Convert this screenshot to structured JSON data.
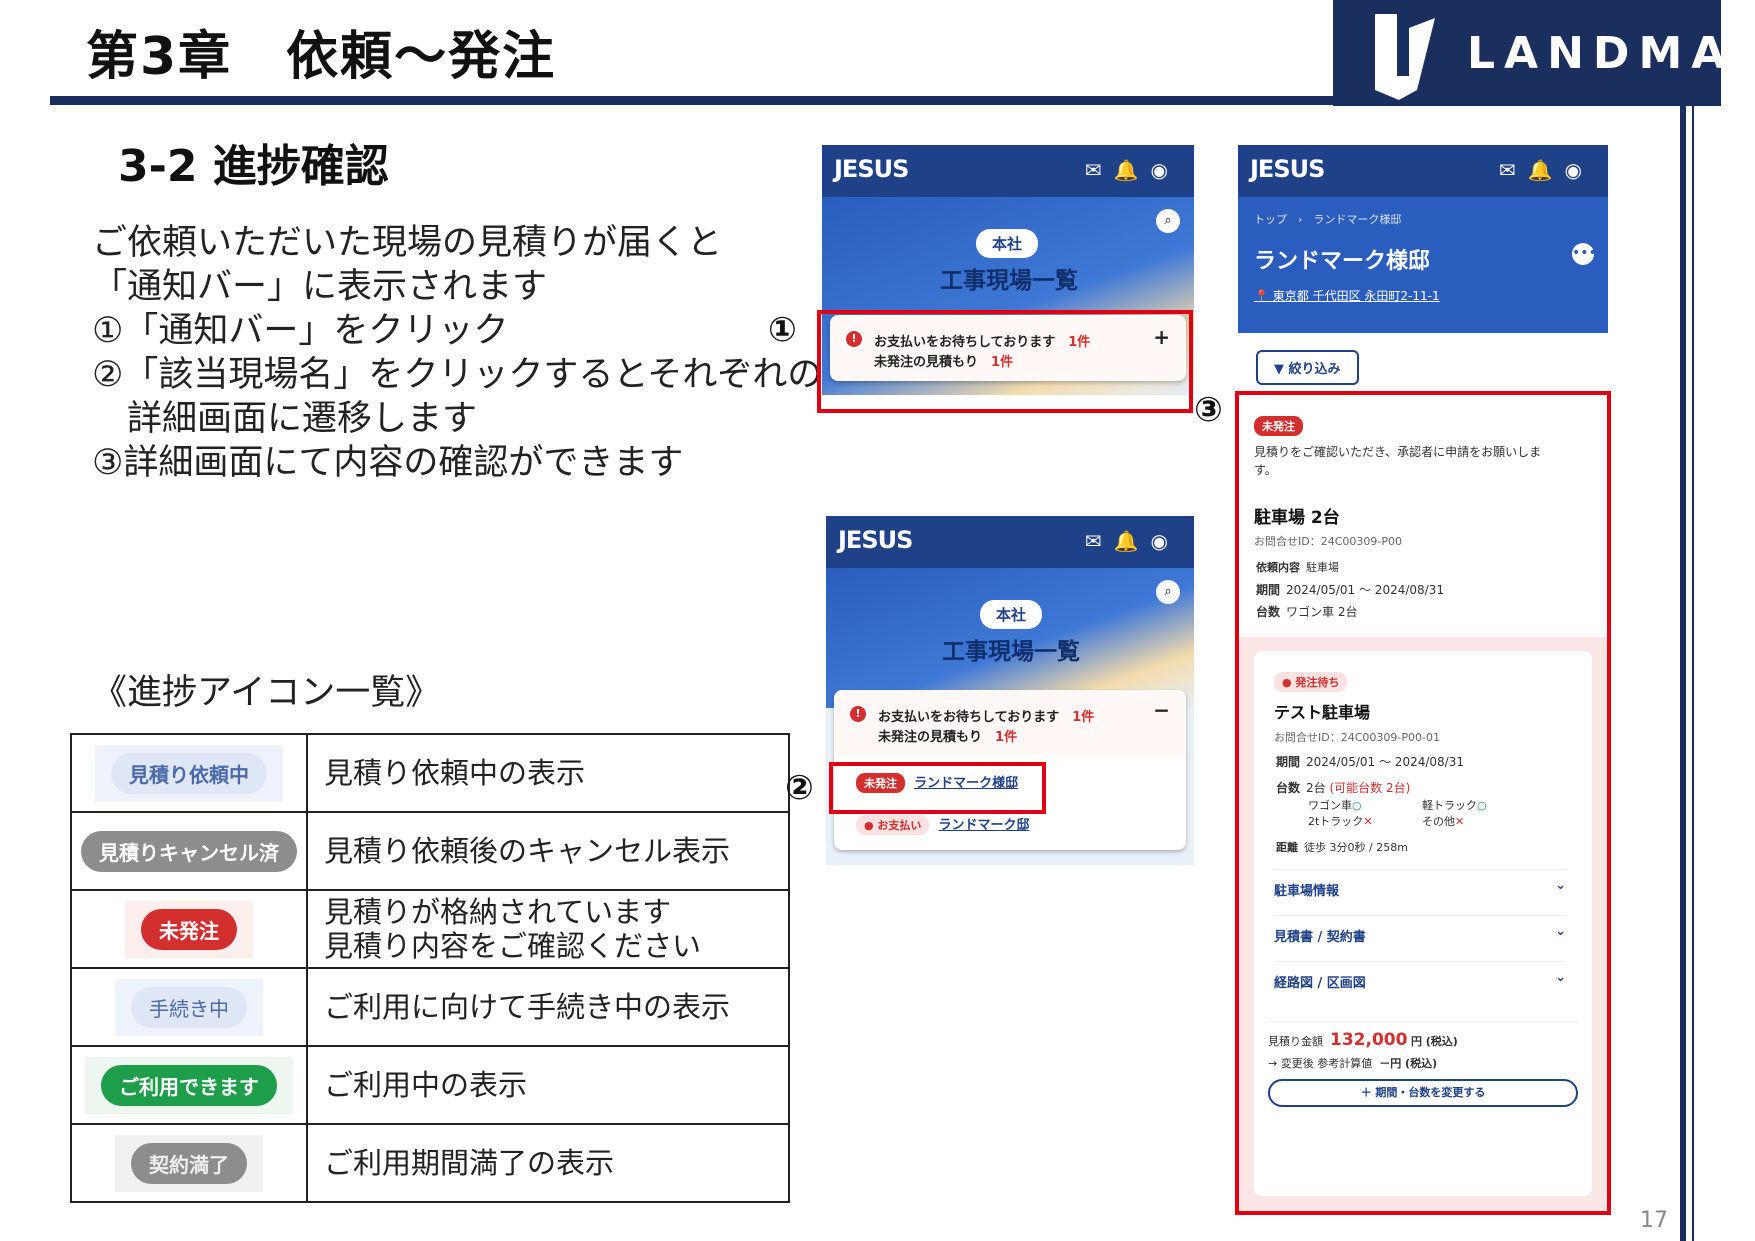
{
  "header": {
    "chapter_title": "第3章　依頼〜発注",
    "logo_text": "LANDMARK",
    "page_number": "17"
  },
  "section": {
    "title": "3-2 進捗確認",
    "lines": [
      "ご依頼いただいた現場の見積りが届くと",
      "「通知バー」に表示されます",
      "①「通知バー」をクリック",
      "②「該当現場名」をクリックするとそれぞれの",
      "　詳細画面に遷移します",
      "③詳細画面にて内容の確認ができます"
    ]
  },
  "icon_list": {
    "title": "《進捗アイコン一覧》",
    "rows": [
      {
        "badge": "見積り依頼中",
        "desc": "見積り依頼中の表示",
        "badge_bg": "#dfe7f6",
        "badge_fg": "#4a6aa8"
      },
      {
        "badge": "見積りキャンセル済",
        "desc": "見積り依頼後のキャンセル表示",
        "badge_bg": "#8d8d8d",
        "badge_fg": "#ffffff"
      },
      {
        "badge": "未発注",
        "desc": "見積りが格納されています",
        "desc2": "見積り内容をご確認ください",
        "badge_bg": "#d32f2f",
        "badge_fg": "#ffffff"
      },
      {
        "badge": "手続き中",
        "desc": "ご利用に向けて手続き中の表示",
        "badge_bg": "#dfe7f6",
        "badge_fg": "#4a6aa8"
      },
      {
        "badge": "ご利用できます",
        "desc": "ご利用中の表示",
        "badge_bg": "#1e9e4a",
        "badge_fg": "#ffffff"
      },
      {
        "badge": "契約満了",
        "desc": "ご利用期間満了の表示",
        "badge_bg": "#8d8d8d",
        "badge_fg": "#ffffff"
      }
    ]
  },
  "screen1": {
    "app_name": "JESUS",
    "hq_label": "本社",
    "title": "工事現場一覧",
    "notif_line1": "お支払いをお待ちしております",
    "notif_count1": "1件",
    "notif_line2": "未発注の見積もり",
    "notif_count2": "1件",
    "toggle": "+",
    "step": "①"
  },
  "screen2": {
    "app_name": "JESUS",
    "hq_label": "本社",
    "title": "工事現場一覧",
    "notif_line1": "お支払いをお待ちしております",
    "notif_count1": "1件",
    "notif_line2": "未発注の見積もり",
    "notif_count2": "1件",
    "toggle": "−",
    "item1_tag": "未発注",
    "item1_link": "ランドマーク様邸",
    "item2_tag": "● お支払い",
    "item2_link": "ランドマーク邸",
    "step": "②"
  },
  "screen3": {
    "app_name": "JESUS",
    "breadcrumb_top": "トップ",
    "breadcrumb_sep": "›",
    "breadcrumb_current": "ランドマーク様邸",
    "site_title": "ランドマーク様邸",
    "address": "東京都 千代田区 永田町2-11-1",
    "filter_button": "絞り込み",
    "step": "③",
    "status_tag": "未発注",
    "message": "見積りをご確認いただき、承認者に申請をお願いしま",
    "message2": "す。",
    "parking_title": "駐車場 2台",
    "inquiry_id": "お問合せID：24C00309-P00",
    "req_label": "依頼内容",
    "req_value": "駐車場",
    "period_label": "期間",
    "period_value": "2024/05/01 〜 2024/08/31",
    "count_label": "台数",
    "count_value": "ワゴン車 2台",
    "card": {
      "tag": "● 発注待ち",
      "name": "テスト駐車場",
      "inquiry_id": "お問合せID：24C00309-P00-01",
      "period_label": "期間",
      "period_value": "2024/05/01 〜 2024/08/31",
      "count_label": "台数",
      "count_value": "2台",
      "count_note": "(可能台数 2台)",
      "wagon": "ワゴン車",
      "light_truck": "軽トラック",
      "truck2t": "2tトラック",
      "other": "その他",
      "ok_mark": "○",
      "ng_mark": "✕",
      "distance_label": "距離",
      "distance_value": "徒歩 3分0秒 / 258m"
    },
    "accordions": [
      "駐車場情報",
      "見積書 / 契約書",
      "経路図 / 区画図"
    ],
    "quote_label": "見積り金額",
    "quote_amount": "132,000",
    "quote_unit": "円 (税込)",
    "changed_label": "→ 変更後 参考計算値",
    "changed_value": "－円 (税込)",
    "change_button": "＋ 期間・台数を変更する"
  },
  "colors": {
    "navy": "#1b2f5e",
    "app_blue": "#1f4187",
    "red_frame": "#e00012"
  }
}
